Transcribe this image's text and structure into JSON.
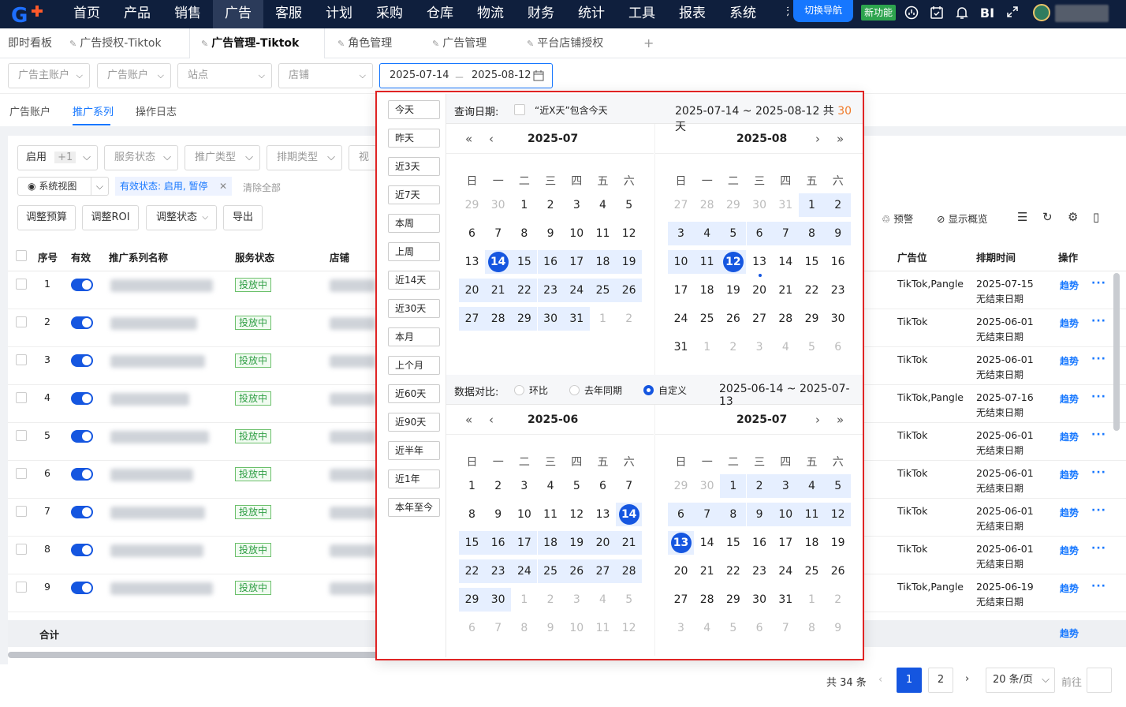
{
  "topnav": {
    "logo": "G",
    "items": [
      "首页",
      "产品",
      "销售",
      "广告",
      "客服",
      "计划",
      "采购",
      "仓库",
      "物流",
      "财务",
      "统计",
      "工具",
      "报表",
      "系统",
      "积"
    ],
    "active_index": 3,
    "switch_nav": "切换导航",
    "new_feature": "新功能",
    "bi": "BI",
    "icons": [
      "headset-icon",
      "calendar-check-icon",
      "bell-icon",
      "bi-icon",
      "fullscreen-icon"
    ]
  },
  "tabs": [
    {
      "label": "即时看板",
      "pinned": false
    },
    {
      "label": "广告授权-Tiktok",
      "pinned": true
    },
    {
      "label": "广告管理-Tiktok",
      "pinned": true,
      "active": true
    },
    {
      "label": "角色管理",
      "pinned": true
    },
    {
      "label": "广告管理",
      "pinned": true
    },
    {
      "label": "平台店铺授权",
      "pinned": true
    },
    {
      "label": "+",
      "pinned": false
    }
  ],
  "filters": {
    "advertiser_main": "广告主账户",
    "ad_account": "广告账户",
    "site": "站点",
    "store": "店铺",
    "date_start": "2025-07-14",
    "date_sep": "－",
    "date_end": "2025-08-12"
  },
  "subtabs": [
    "广告账户",
    "推广系列",
    "操作日志"
  ],
  "subtab_active": 1,
  "toolbar": {
    "enabled": "启用",
    "enabled_count": "+1",
    "service_status": "服务状态",
    "promo_type": "推广类型",
    "schedule_type": "排期类型",
    "video": "视频",
    "system_view": "系统视图",
    "active_filter": "有效状态: 启用, 暂停",
    "clear_all": "清除全部",
    "adjust_budget": "调整预算",
    "adjust_roi": "调整ROI",
    "adjust_status": "调整状态",
    "export": "导出",
    "alert": "预警",
    "show_overview": "显示概览"
  },
  "table": {
    "headers": {
      "index": "序号",
      "valid": "有效",
      "name": "推广系列名称",
      "service_status": "服务状态",
      "store": "店铺",
      "placement": "广告位",
      "schedule": "排期时间",
      "ops": "操作"
    },
    "rows": [
      {
        "index": "1",
        "status": "投放中",
        "placement": "TikTok,Pangle",
        "date": "2025-07-15",
        "end": "无结束日期"
      },
      {
        "index": "2",
        "status": "投放中",
        "placement": "TikTok",
        "date": "2025-06-01",
        "end": "无结束日期"
      },
      {
        "index": "3",
        "status": "投放中",
        "placement": "TikTok",
        "date": "2025-06-01",
        "end": "无结束日期"
      },
      {
        "index": "4",
        "status": "投放中",
        "placement": "TikTok,Pangle",
        "date": "2025-07-16",
        "end": "无结束日期"
      },
      {
        "index": "5",
        "status": "投放中",
        "placement": "TikTok",
        "date": "2025-06-01",
        "end": "无结束日期"
      },
      {
        "index": "6",
        "status": "投放中",
        "placement": "TikTok",
        "date": "2025-06-01",
        "end": "无结束日期"
      },
      {
        "index": "7",
        "status": "投放中",
        "placement": "TikTok",
        "date": "2025-06-01",
        "end": "无结束日期"
      },
      {
        "index": "8",
        "status": "投放中",
        "placement": "TikTok",
        "date": "2025-06-01",
        "end": "无结束日期"
      },
      {
        "index": "9",
        "status": "投放中",
        "placement": "TikTok,Pangle",
        "date": "2025-06-19",
        "end": "无结束日期"
      }
    ],
    "trend": "趋势",
    "more": "···",
    "sum_label": "合计"
  },
  "pagination": {
    "total": "共 34 条",
    "pages": [
      "1",
      "2"
    ],
    "current": "1",
    "per_page": "20 条/页",
    "goto": "前往"
  },
  "picker": {
    "shortcuts": [
      "今天",
      "昨天",
      "近3天",
      "近7天",
      "本周",
      "上周",
      "近14天",
      "近30天",
      "本月",
      "上个月",
      "近60天",
      "近90天",
      "近半年",
      "近1年",
      "本年至今"
    ],
    "query_label": "查询日期:",
    "include_today": "“近X天”包含今天",
    "query_range": "2025-07-14 ~ 2025-08-12 共",
    "query_days": "30",
    "query_days_unit": "天",
    "compare_label": "数据对比:",
    "compare_options": [
      "环比",
      "去年同期",
      "自定义"
    ],
    "compare_selected": 2,
    "compare_range": "2025-06-14 ~ 2025-07-13",
    "weekdays": [
      "日",
      "一",
      "二",
      "三",
      "四",
      "五",
      "六"
    ],
    "month_labels": [
      "2025-07",
      "2025-08",
      "2025-06",
      "2025-07"
    ],
    "calendars": [
      {
        "weeks": [
          [
            "29",
            "30",
            "1",
            "2",
            "3",
            "4",
            "5"
          ],
          [
            "6",
            "7",
            "8",
            "9",
            "10",
            "11",
            "12"
          ],
          [
            "13",
            "14",
            "15",
            "16",
            "17",
            "18",
            "19"
          ],
          [
            "20",
            "21",
            "22",
            "23",
            "24",
            "25",
            "26"
          ],
          [
            "27",
            "28",
            "29",
            "30",
            "31",
            "1",
            "2"
          ]
        ],
        "out": [
          [
            0,
            0
          ],
          [
            0,
            1
          ],
          [
            4,
            5
          ],
          [
            4,
            6
          ]
        ],
        "range": [
          [
            2,
            1
          ],
          [
            4,
            4
          ]
        ],
        "endpoints": [
          [
            2,
            1
          ]
        ]
      },
      {
        "weeks": [
          [
            "27",
            "28",
            "29",
            "30",
            "31",
            "1",
            "2"
          ],
          [
            "3",
            "4",
            "5",
            "6",
            "7",
            "8",
            "9"
          ],
          [
            "10",
            "11",
            "12",
            "13",
            "14",
            "15",
            "16"
          ],
          [
            "17",
            "18",
            "19",
            "20",
            "21",
            "22",
            "23"
          ],
          [
            "24",
            "25",
            "26",
            "27",
            "28",
            "29",
            "30"
          ],
          [
            "31",
            "1",
            "2",
            "3",
            "4",
            "5",
            "6"
          ]
        ],
        "out": [
          [
            0,
            0
          ],
          [
            0,
            1
          ],
          [
            0,
            2
          ],
          [
            0,
            3
          ],
          [
            0,
            4
          ],
          [
            5,
            1
          ],
          [
            5,
            2
          ],
          [
            5,
            3
          ],
          [
            5,
            4
          ],
          [
            5,
            5
          ],
          [
            5,
            6
          ]
        ],
        "range": [
          [
            0,
            5
          ],
          [
            2,
            2
          ]
        ],
        "endpoints": [
          [
            2,
            2
          ]
        ],
        "today": [
          2,
          3
        ]
      },
      {
        "weeks": [
          [
            "1",
            "2",
            "3",
            "4",
            "5",
            "6",
            "7"
          ],
          [
            "8",
            "9",
            "10",
            "11",
            "12",
            "13",
            "14"
          ],
          [
            "15",
            "16",
            "17",
            "18",
            "19",
            "20",
            "21"
          ],
          [
            "22",
            "23",
            "24",
            "25",
            "26",
            "27",
            "28"
          ],
          [
            "29",
            "30",
            "1",
            "2",
            "3",
            "4",
            "5"
          ],
          [
            "6",
            "7",
            "8",
            "9",
            "10",
            "11",
            "12"
          ]
        ],
        "out": [
          [
            4,
            2
          ],
          [
            4,
            3
          ],
          [
            4,
            4
          ],
          [
            4,
            5
          ],
          [
            4,
            6
          ],
          [
            5,
            0
          ],
          [
            5,
            1
          ],
          [
            5,
            2
          ],
          [
            5,
            3
          ],
          [
            5,
            4
          ],
          [
            5,
            5
          ],
          [
            5,
            6
          ]
        ],
        "range": [
          [
            1,
            6
          ],
          [
            4,
            1
          ]
        ],
        "endpoints": [
          [
            1,
            6
          ]
        ]
      },
      {
        "weeks": [
          [
            "29",
            "30",
            "1",
            "2",
            "3",
            "4",
            "5"
          ],
          [
            "6",
            "7",
            "8",
            "9",
            "10",
            "11",
            "12"
          ],
          [
            "13",
            "14",
            "15",
            "16",
            "17",
            "18",
            "19"
          ],
          [
            "20",
            "21",
            "22",
            "23",
            "24",
            "25",
            "26"
          ],
          [
            "27",
            "28",
            "29",
            "30",
            "31",
            "1",
            "2"
          ],
          [
            "3",
            "4",
            "5",
            "6",
            "7",
            "8",
            "9"
          ]
        ],
        "out": [
          [
            0,
            0
          ],
          [
            0,
            1
          ],
          [
            4,
            5
          ],
          [
            4,
            6
          ],
          [
            5,
            0
          ],
          [
            5,
            1
          ],
          [
            5,
            2
          ],
          [
            5,
            3
          ],
          [
            5,
            4
          ],
          [
            5,
            5
          ],
          [
            5,
            6
          ]
        ],
        "range": [
          [
            0,
            2
          ],
          [
            2,
            0
          ]
        ],
        "endpoints": [
          [
            2,
            0
          ]
        ]
      }
    ]
  }
}
